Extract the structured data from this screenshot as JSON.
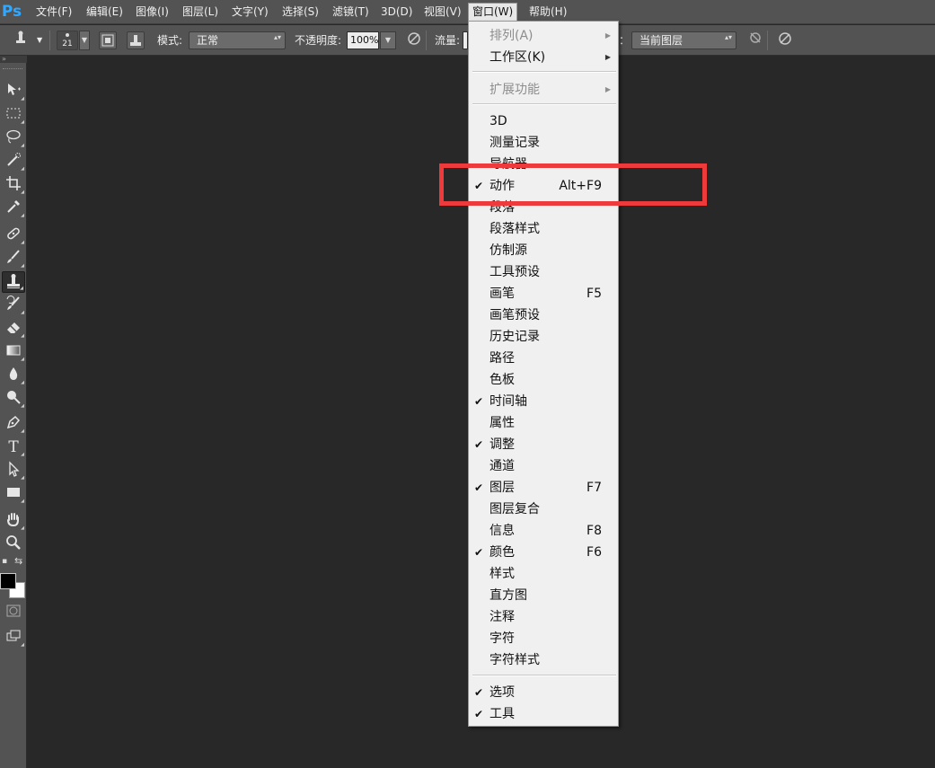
{
  "app": {
    "logo": "Ps"
  },
  "menubar": [
    {
      "label": "文件(F)"
    },
    {
      "label": "编辑(E)"
    },
    {
      "label": "图像(I)"
    },
    {
      "label": "图层(L)"
    },
    {
      "label": "文字(Y)"
    },
    {
      "label": "选择(S)"
    },
    {
      "label": "滤镜(T)"
    },
    {
      "label": "3D(D)"
    },
    {
      "label": "视图(V)"
    },
    {
      "label": "窗口(W)"
    },
    {
      "label": "帮助(H)"
    }
  ],
  "options": {
    "brush_size": "21",
    "mode_label": "模式:",
    "mode_value": "正常",
    "opacity_label": "不透明度:",
    "opacity_value": "100%",
    "flow_label": "流量:",
    "sample_suffix": "：",
    "sample_value": "当前图层"
  },
  "tools": [
    {
      "icon": "move-icon"
    },
    {
      "icon": "marquee-icon"
    },
    {
      "icon": "lasso-icon"
    },
    {
      "icon": "quick-select-icon"
    },
    {
      "icon": "crop-icon"
    },
    {
      "icon": "eyedropper-icon"
    },
    {
      "icon": "healing-brush-icon"
    },
    {
      "icon": "brush-icon"
    },
    {
      "icon": "clone-stamp-icon"
    },
    {
      "icon": "history-brush-icon"
    },
    {
      "icon": "eraser-icon"
    },
    {
      "icon": "gradient-icon"
    },
    {
      "icon": "blur-icon"
    },
    {
      "icon": "dodge-icon"
    },
    {
      "icon": "pen-icon"
    },
    {
      "icon": "type-icon"
    },
    {
      "icon": "path-select-icon"
    },
    {
      "icon": "rectangle-icon"
    },
    {
      "icon": "hand-icon"
    },
    {
      "icon": "zoom-icon"
    }
  ],
  "tool_text": {
    "type": "T"
  },
  "window_menu": {
    "items": [
      {
        "label": "排列(A)",
        "disabled": true,
        "submenu": true
      },
      {
        "label": "工作区(K)",
        "submenu": true
      },
      {
        "label": "扩展功能",
        "disabled": true,
        "submenu": true
      },
      {
        "label": "3D"
      },
      {
        "label": "测量记录"
      },
      {
        "label": "导航器"
      },
      {
        "label": "动作",
        "checked": true,
        "shortcut": "Alt+F9"
      },
      {
        "label": "段落"
      },
      {
        "label": "段落样式"
      },
      {
        "label": "仿制源"
      },
      {
        "label": "工具预设"
      },
      {
        "label": "画笔",
        "shortcut": "F5"
      },
      {
        "label": "画笔预设"
      },
      {
        "label": "历史记录"
      },
      {
        "label": "路径"
      },
      {
        "label": "色板"
      },
      {
        "label": "时间轴",
        "checked": true
      },
      {
        "label": "属性"
      },
      {
        "label": "调整",
        "checked": true
      },
      {
        "label": "通道"
      },
      {
        "label": "图层",
        "checked": true,
        "shortcut": "F7"
      },
      {
        "label": "图层复合"
      },
      {
        "label": "信息",
        "shortcut": "F8"
      },
      {
        "label": "颜色",
        "checked": true,
        "shortcut": "F6"
      },
      {
        "label": "样式"
      },
      {
        "label": "直方图"
      },
      {
        "label": "注释"
      },
      {
        "label": "字符"
      },
      {
        "label": "字符样式"
      },
      {
        "label": "选项",
        "checked": true
      },
      {
        "label": "工具",
        "checked": true
      }
    ]
  },
  "glyphs": {
    "check": "✔",
    "submenu": "▶",
    "dropdown": "▼",
    "spinner": "▴▾"
  },
  "colors": {
    "highlight": "#ee3a3a",
    "app_bg": "#282828",
    "panel": "#535353",
    "menu_bg": "#f0f0f0"
  }
}
